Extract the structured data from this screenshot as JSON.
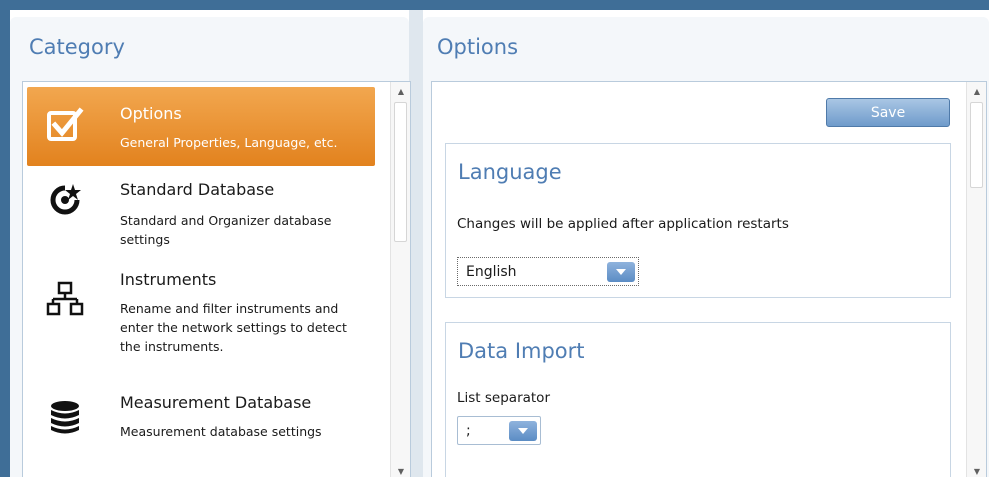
{
  "category_panel": {
    "title": "Category",
    "items": [
      {
        "icon": "checkbox-check-icon",
        "title": "Options",
        "description": "General Properties, Language, etc.",
        "selected": true
      },
      {
        "icon": "target-star-icon",
        "title": "Standard Database",
        "description": "Standard and Organizer database settings",
        "selected": false
      },
      {
        "icon": "network-hierarchy-icon",
        "title": "Instruments",
        "description": "Rename and filter instruments and enter the network settings to detect the instruments.",
        "selected": false
      },
      {
        "icon": "database-icon",
        "title": "Measurement Database",
        "description": "Measurement database settings",
        "selected": false
      }
    ]
  },
  "options_panel": {
    "title": "Options",
    "save_label": "Save",
    "language": {
      "title": "Language",
      "note": "Changes will be applied after application restarts",
      "selected": "English"
    },
    "data_import": {
      "title": "Data Import",
      "separator_label": "List separator",
      "separator_value": ";"
    }
  },
  "colors": {
    "accent": "#4f7db3",
    "selected_item": "#e98d2a",
    "frame": "#3f6e97"
  }
}
